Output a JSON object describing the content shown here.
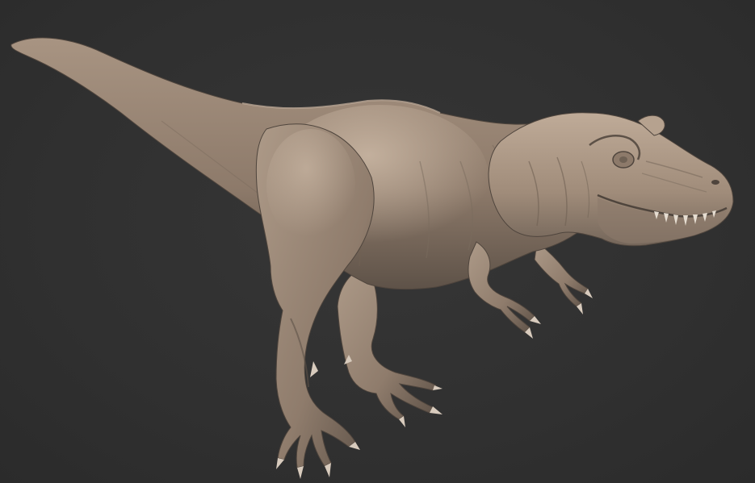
{
  "scene": {
    "subject": "tyrannosaurus-sculpt",
    "colors": {
      "background": "#303030",
      "skin_light": "#b9a592",
      "skin_mid": "#9c8877",
      "skin_dark": "#6f6154",
      "skin_shadow": "#4f453d",
      "claw": "#d8cbbd",
      "tooth": "#e6ddd1"
    }
  }
}
